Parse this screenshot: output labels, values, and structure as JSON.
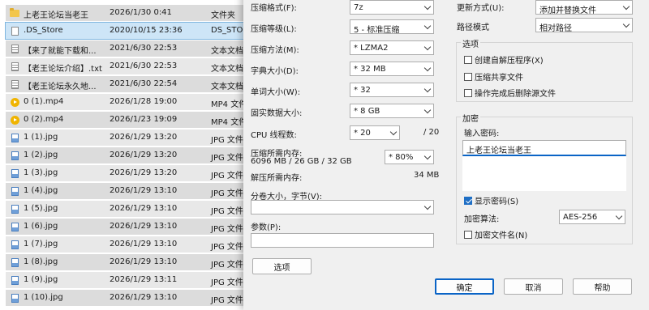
{
  "files": [
    {
      "name": "上老王论坛当老王",
      "date": "2026/1/30 0:41",
      "type": "文件夹",
      "icon": "folder-icon"
    },
    {
      "name": ".DS_Store",
      "date": "2020/10/15 23:36",
      "type": "DS_STORE",
      "icon": "file-icon"
    },
    {
      "name": "【来了就能下载和...",
      "date": "2021/6/30 22:53",
      "type": "文本文档",
      "icon": "text-file-icon"
    },
    {
      "name": "【老王论坛介绍】.txt",
      "date": "2021/6/30 22:53",
      "type": "文本文档",
      "icon": "text-file-icon"
    },
    {
      "name": "【老王论坛永久地...",
      "date": "2021/6/30 22:54",
      "type": "文本文档",
      "icon": "text-file-icon"
    },
    {
      "name": "0 (1).mp4",
      "date": "2026/1/28 19:00",
      "type": "MP4 文件",
      "icon": "video-file-icon"
    },
    {
      "name": "0 (2).mp4",
      "date": "2026/1/23 19:09",
      "type": "MP4 文件",
      "icon": "video-file-icon"
    },
    {
      "name": "1 (1).jpg",
      "date": "2026/1/29 13:20",
      "type": "JPG 文件",
      "icon": "image-file-icon"
    },
    {
      "name": "1 (2).jpg",
      "date": "2026/1/29 13:20",
      "type": "JPG 文件",
      "icon": "image-file-icon"
    },
    {
      "name": "1 (3).jpg",
      "date": "2026/1/29 13:20",
      "type": "JPG 文件",
      "icon": "image-file-icon"
    },
    {
      "name": "1 (4).jpg",
      "date": "2026/1/29 13:10",
      "type": "JPG 文件",
      "icon": "image-file-icon"
    },
    {
      "name": "1 (5).jpg",
      "date": "2026/1/29 13:10",
      "type": "JPG 文件",
      "icon": "image-file-icon"
    },
    {
      "name": "1 (6).jpg",
      "date": "2026/1/29 13:10",
      "type": "JPG 文件",
      "icon": "image-file-icon"
    },
    {
      "name": "1 (7).jpg",
      "date": "2026/1/29 13:10",
      "type": "JPG 文件",
      "icon": "image-file-icon"
    },
    {
      "name": "1 (8).jpg",
      "date": "2026/1/29 13:10",
      "type": "JPG 文件",
      "icon": "image-file-icon"
    },
    {
      "name": "1 (9).jpg",
      "date": "2026/1/29 13:11",
      "type": "JPG 文件",
      "icon": "image-file-icon"
    },
    {
      "name": "1 (10).jpg",
      "date": "2026/1/29 13:10",
      "type": "JPG 文件",
      "icon": "image-file-icon"
    }
  ],
  "dialog": {
    "format_label": "压缩格式(F):",
    "format_value": "7z",
    "level_label": "压缩等级(L):",
    "level_value": "5 - 标准压缩",
    "method_label": "压缩方法(M):",
    "method_value": "* LZMA2",
    "dict_label": "字典大小(D):",
    "dict_value": "* 32 MB",
    "word_label": "单词大小(W):",
    "word_value": "* 32",
    "solid_label": "固实数据大小:",
    "solid_value": "* 8 GB",
    "threads_label": "CPU 线程数:",
    "threads_value": "* 20",
    "threads_total": "/ 20",
    "mem_label": "压缩所需内存:",
    "mem_value": "6096 MB / 26 GB / 32 GB",
    "mem_percent": "* 80%",
    "decomp_label": "解压所需内存:",
    "decomp_value": "34 MB",
    "split_label": "分卷大小，字节(V):",
    "params_label": "参数(P):",
    "options_button": "选项",
    "update_label": "更新方式(U):",
    "update_value": "添加并替换文件",
    "path_label": "路径模式",
    "path_value": "相对路径",
    "options_group": "选项",
    "opt_sfx": "创建自解压程序(X)",
    "opt_shared": "压缩共享文件",
    "opt_delete": "操作完成后删除源文件",
    "encrypt_group": "加密",
    "password_label": "输入密码:",
    "password_value": "上老王论坛当老王",
    "show_password": "显示密码(S)",
    "enc_method_label": "加密算法:",
    "enc_method_value": "AES-256",
    "encrypt_names": "加密文件名(N)",
    "ok": "确定",
    "cancel": "取消",
    "help": "帮助"
  }
}
